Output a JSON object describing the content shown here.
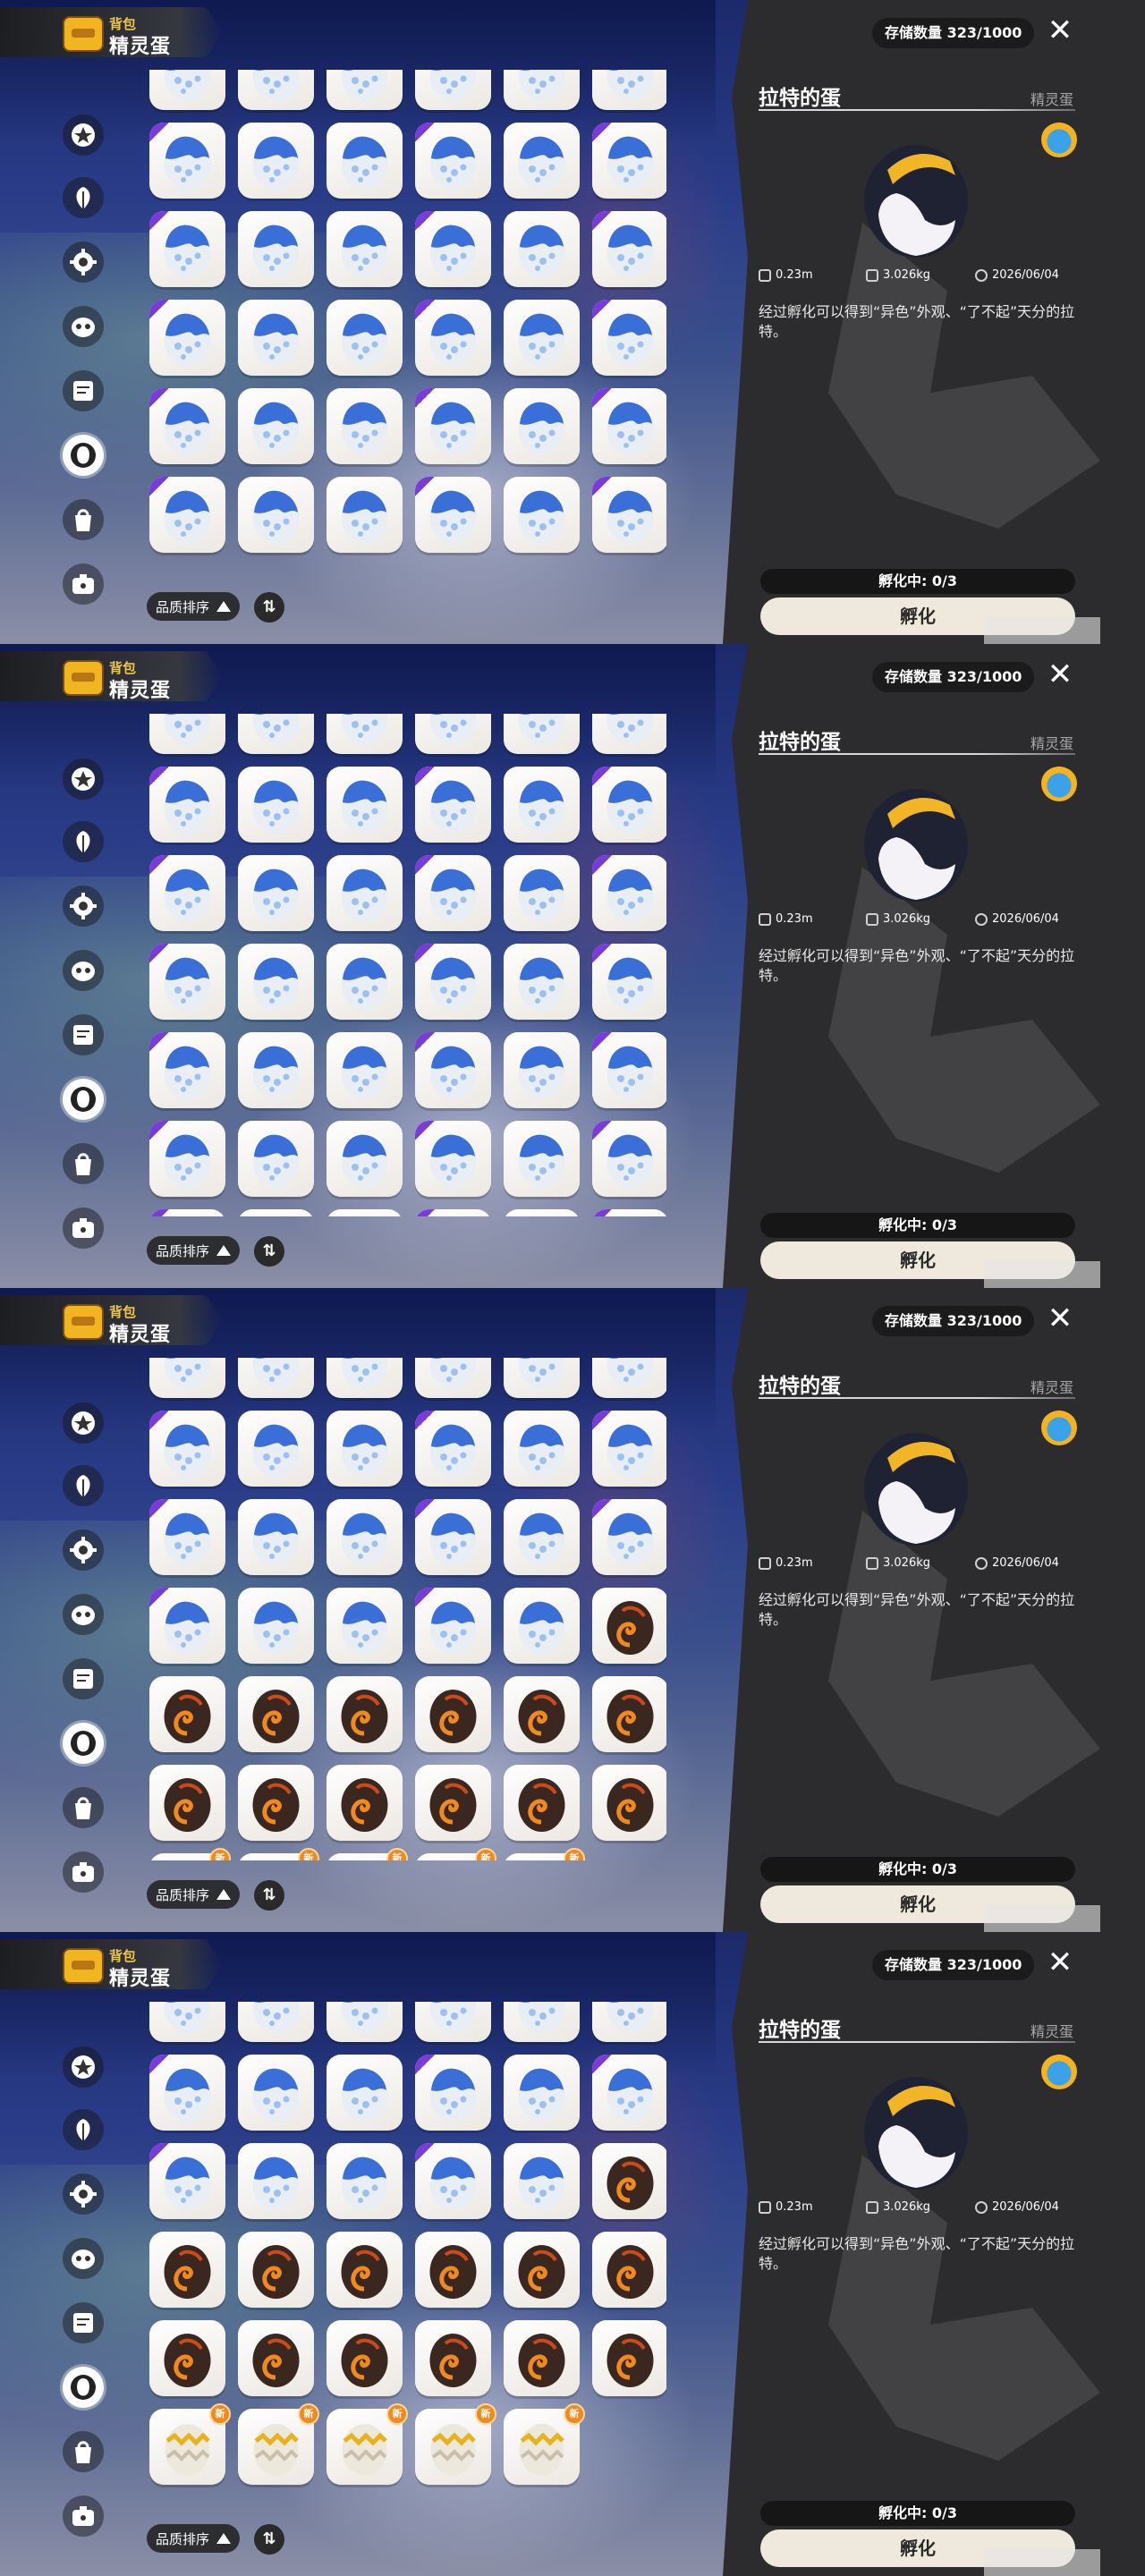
{
  "header": {
    "subtitle": "背包",
    "title": "精灵蛋"
  },
  "sidebar": {
    "items": [
      {
        "name": "sidebar-item-star",
        "icon": "star-badge-icon"
      },
      {
        "name": "sidebar-item-leaf",
        "icon": "leaf-icon"
      },
      {
        "name": "sidebar-item-gear",
        "icon": "gear-icon"
      },
      {
        "name": "sidebar-item-mask",
        "icon": "mask-icon"
      },
      {
        "name": "sidebar-item-card",
        "icon": "card-icon"
      },
      {
        "name": "sidebar-item-egg",
        "icon": "egg-icon"
      },
      {
        "name": "sidebar-item-bag",
        "icon": "bag-icon"
      },
      {
        "name": "sidebar-item-box",
        "icon": "box-icon"
      }
    ],
    "active_index": 5
  },
  "toolbar": {
    "sort_label": "品质排序",
    "sort_dir_icon": "triangle-up-icon",
    "swap_icon": "swap-arrows-icon"
  },
  "detail": {
    "storage": "存储数量 323/1000",
    "close_icon": "close-icon",
    "egg_name": "拉特的蛋",
    "egg_category": "精灵蛋",
    "attribute_icon": "attribute-badge-icon",
    "stats": [
      {
        "icon": "ruler-icon",
        "value": "0.23m"
      },
      {
        "icon": "weight-icon",
        "value": "3.026kg"
      },
      {
        "icon": "eye-icon",
        "value": "2026/06/04"
      }
    ],
    "description": "经过孵化可以得到“异色”外观、“了不起”天分的拉特。",
    "hatching": "孵化中: 0/3",
    "hatch_button": "孵化"
  },
  "frames": [
    {
      "first_row_partial": true,
      "rows": [
        [
          "blue",
          "blue",
          "blue",
          "blue",
          "blue",
          "blue"
        ],
        [
          "blue",
          "blue",
          "blue",
          "blue",
          "blue",
          "blue"
        ],
        [
          "blue",
          "blue",
          "blue",
          "blue",
          "blue",
          "blue"
        ],
        [
          "blue",
          "blue",
          "blue",
          "blue",
          "blue",
          "blue"
        ],
        [
          "blue",
          "blue",
          "blue",
          "blue",
          "blue",
          "blue"
        ],
        [
          "blue",
          "blue",
          "blue",
          "blue",
          "blue",
          "blue"
        ]
      ]
    },
    {
      "first_row_partial": true,
      "rows": [
        [
          "blue",
          "blue",
          "blue",
          "blue",
          "blue",
          "blue"
        ],
        [
          "blue",
          "blue",
          "blue",
          "blue",
          "blue",
          "blue"
        ],
        [
          "blue",
          "blue",
          "blue",
          "blue",
          "blue",
          "blue"
        ],
        [
          "blue",
          "blue",
          "blue",
          "blue",
          "blue",
          "blue"
        ],
        [
          "blue",
          "blue",
          "blue",
          "blue",
          "blue",
          "blue"
        ],
        [
          "blue",
          "blue",
          "blue",
          "blue",
          "blue",
          "blue"
        ],
        [
          "blue",
          "blue",
          "blue",
          "blue",
          "blue",
          "blue"
        ]
      ]
    },
    {
      "first_row_partial": true,
      "rows": [
        [
          "blue",
          "blue",
          "blue",
          "blue",
          "blue",
          "blue"
        ],
        [
          "blue",
          "blue",
          "blue",
          "blue",
          "blue",
          "blue"
        ],
        [
          "blue",
          "blue",
          "blue",
          "blue",
          "blue",
          "blue"
        ],
        [
          "blue",
          "blue",
          "blue",
          "blue",
          "blue",
          "fire"
        ],
        [
          "fire",
          "fire",
          "fire",
          "fire",
          "fire",
          "fire"
        ],
        [
          "fire",
          "fire",
          "fire",
          "fire",
          "fire",
          "fire"
        ],
        [
          "gold",
          "gold",
          "gold",
          "gold",
          "gold",
          ""
        ]
      ]
    },
    {
      "first_row_partial": true,
      "rows": [
        [
          "blue",
          "blue",
          "blue",
          "blue",
          "blue",
          "blue"
        ],
        [
          "blue",
          "blue",
          "blue",
          "blue",
          "blue",
          "blue"
        ],
        [
          "blue",
          "blue",
          "blue",
          "blue",
          "blue",
          "fire"
        ],
        [
          "fire",
          "fire",
          "fire",
          "fire",
          "fire",
          "fire"
        ],
        [
          "fire",
          "fire",
          "fire",
          "fire",
          "fire",
          "fire"
        ],
        [
          "gold",
          "gold",
          "gold",
          "gold",
          "gold",
          ""
        ]
      ]
    }
  ],
  "badge_text": "新",
  "colors": {
    "panel": "#2c2c2e",
    "accent_gold": "#f1c64b",
    "button": "#efe8dc",
    "purple_corner": "#7a3bd8"
  }
}
